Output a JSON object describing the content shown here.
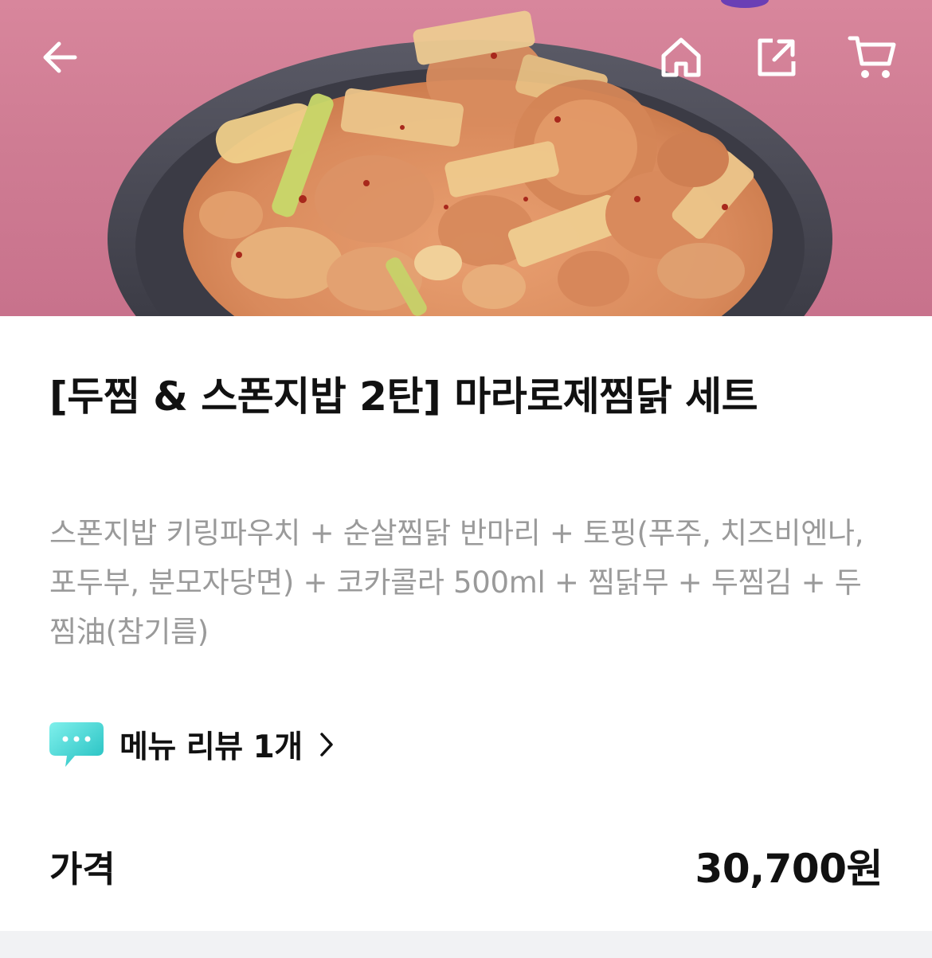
{
  "header": {
    "back_icon": "arrow-left-icon",
    "home_icon": "home-icon",
    "share_icon": "share-icon",
    "cart_icon": "cart-icon",
    "icon_color": "#ffffff"
  },
  "product": {
    "title": "[두찜 & 스폰지밥 2탄] 마라로제찜닭 세트",
    "description": "스폰지밥 키링파우치 + 순살찜닭 반마리 + 토핑(푸주, 치즈비엔나, 포두부, 분모자당면) + 코카콜라 500ml + 찜닭무 + 두찜김 + 두찜油(참기름)",
    "review_icon": "speech-bubble-icon",
    "review_label": "메뉴 리뷰 1개",
    "review_chevron_icon": "chevron-right-icon",
    "price_label": "가격",
    "price_value": "30,700원"
  },
  "colors": {
    "hero_background": "#cf7c93",
    "title_text": "#111111",
    "description_text": "#9a9a9a",
    "review_icon": "#3ad2d0",
    "bottom_strip": "#f1f2f4"
  }
}
